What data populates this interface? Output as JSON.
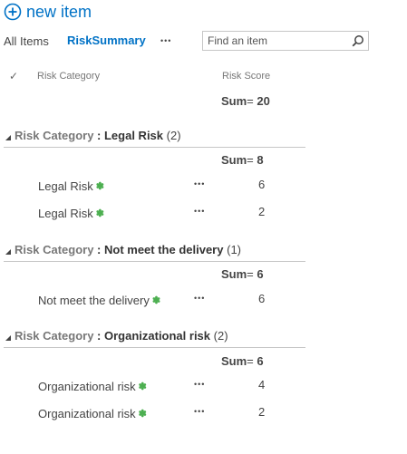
{
  "toolbar": {
    "new_item_label": "new item"
  },
  "views": {
    "all_items": "All Items",
    "current": "RiskSummary",
    "more": "•••"
  },
  "search": {
    "placeholder": "Find an item"
  },
  "columns": {
    "check": "✓",
    "category": "Risk Category",
    "score": "Risk Score"
  },
  "total": {
    "label": "Sum",
    "eq": "=",
    "value": "20"
  },
  "groups": [
    {
      "field": "Risk Category",
      "sep": " : ",
      "name": "Legal Risk",
      "count": "(2)",
      "sum_label": "Sum",
      "sum_eq": "=",
      "sum_value": "8",
      "rows": [
        {
          "title": "Legal Risk",
          "badge": "✽",
          "dots": "•••",
          "score": "6"
        },
        {
          "title": "Legal Risk",
          "badge": "✽",
          "dots": "•••",
          "score": "2"
        }
      ]
    },
    {
      "field": "Risk Category",
      "sep": " : ",
      "name": "Not meet the delivery",
      "count": "(1)",
      "sum_label": "Sum",
      "sum_eq": "=",
      "sum_value": "6",
      "rows": [
        {
          "title": "Not meet the delivery",
          "badge": "✽",
          "dots": "•••",
          "score": "6"
        }
      ]
    },
    {
      "field": "Risk Category",
      "sep": " : ",
      "name": "Organizational risk",
      "count": "(2)",
      "sum_label": "Sum",
      "sum_eq": "=",
      "sum_value": "6",
      "rows": [
        {
          "title": "Organizational risk",
          "badge": "✽",
          "dots": "•••",
          "score": "4"
        },
        {
          "title": "Organizational risk",
          "badge": "✽",
          "dots": "•••",
          "score": "2"
        }
      ]
    }
  ]
}
